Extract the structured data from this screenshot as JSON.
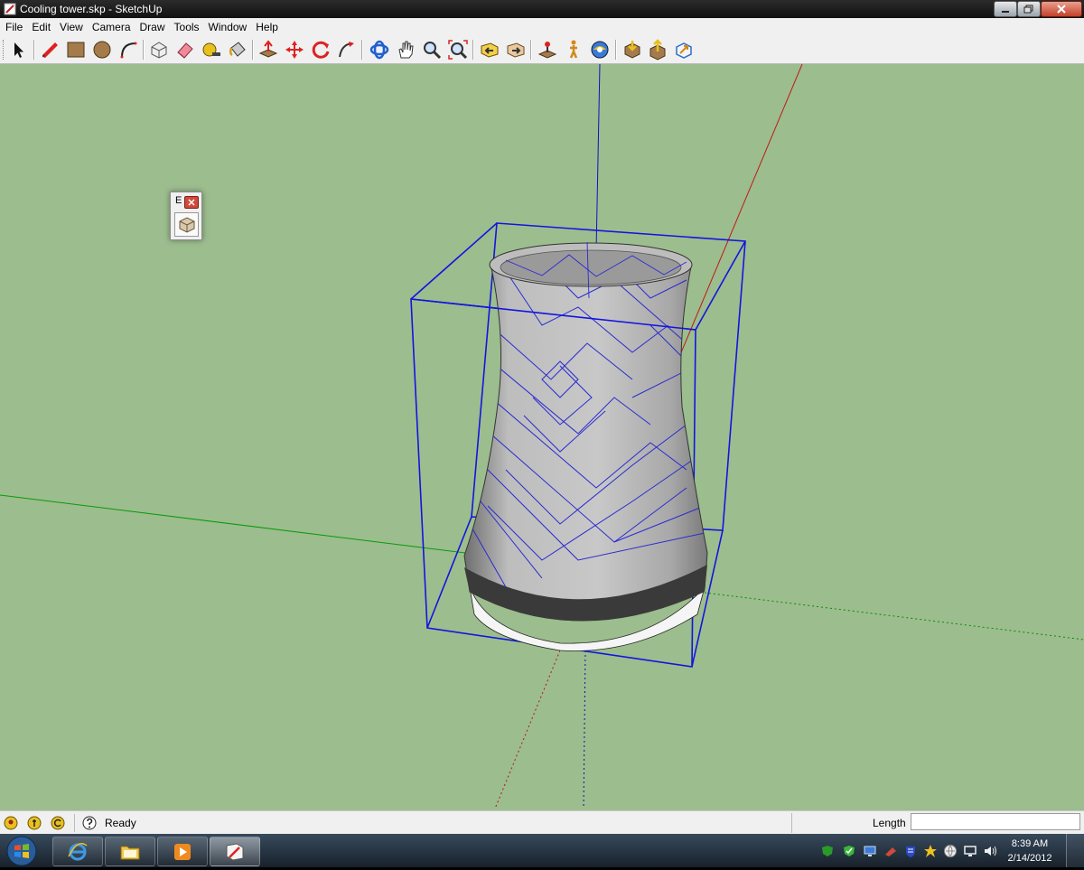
{
  "window": {
    "title": "Cooling tower.skp - SketchUp"
  },
  "menu": [
    "File",
    "Edit",
    "View",
    "Camera",
    "Draw",
    "Tools",
    "Window",
    "Help"
  ],
  "palette": {
    "title": "E"
  },
  "status": {
    "text": "Ready",
    "length_label": "Length",
    "length_value": ""
  },
  "taskbar": {
    "time": "8:39 AM",
    "date": "2/14/2012"
  },
  "colors": {
    "viewport_bg": "#9cbd8e",
    "axis_blue": "#0000cc",
    "axis_red": "#cc0000",
    "axis_green": "#00aa00",
    "selection_box": "#1010e0"
  },
  "toolbar": {
    "tools": [
      "select-icon",
      "pencil-icon",
      "rectangle-icon",
      "circle-icon",
      "arc-icon",
      "make-component-icon",
      "eraser-icon",
      "tape-measure-icon",
      "paint-bucket-icon",
      "push-pull-icon",
      "move-icon",
      "rotate-icon",
      "follow-me-icon",
      "orbit-icon",
      "pan-icon",
      "zoom-icon",
      "zoom-extents-icon",
      "previous-view-icon",
      "next-view-icon",
      "position-camera-icon",
      "walk-icon",
      "look-around-icon",
      "get-models-icon",
      "share-model-icon",
      "google-earth-icon"
    ]
  }
}
